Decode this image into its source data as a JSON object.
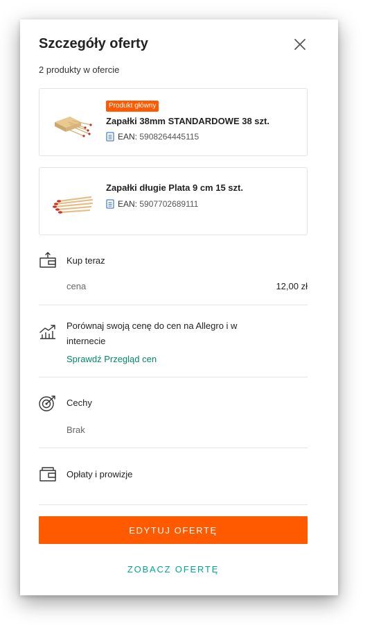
{
  "header": {
    "title": "Szczegóły oferty",
    "subtitle": "2 produkty w ofercie",
    "close_icon": "close-icon"
  },
  "products": [
    {
      "badge": "Produkt główny",
      "name": "Zapałki 38mm STANDARDOWE 38 szt.",
      "ean_label": "EAN:",
      "ean_value": "5908264445115",
      "image": "matchbox-image"
    },
    {
      "name": "Zapałki długie Plata 9 cm 15 szt.",
      "ean_label": "EAN:",
      "ean_value": "5907702689111",
      "image": "long-matches-image"
    }
  ],
  "sections": {
    "buy_now": {
      "label": "Kup teraz",
      "price_label": "cena",
      "price_value": "12,00 zł",
      "icon": "wallet-upload-icon"
    },
    "compare": {
      "label": "Porównaj swoją cenę do cen na Allegro i w internecie",
      "link": "Sprawdź Przegląd cen",
      "icon": "chart-trend-icon"
    },
    "features": {
      "label": "Cechy",
      "value": "Brak",
      "icon": "target-icon"
    },
    "fees": {
      "label": "Opłaty i prowizje",
      "icon": "wallet-icon"
    }
  },
  "actions": {
    "edit": "EDYTUJ OFERTĘ",
    "view": "ZOBACZ OFERTĘ"
  },
  "colors": {
    "accent": "#ff5a00",
    "link": "#00876b",
    "secondary_button": "#00a790"
  }
}
